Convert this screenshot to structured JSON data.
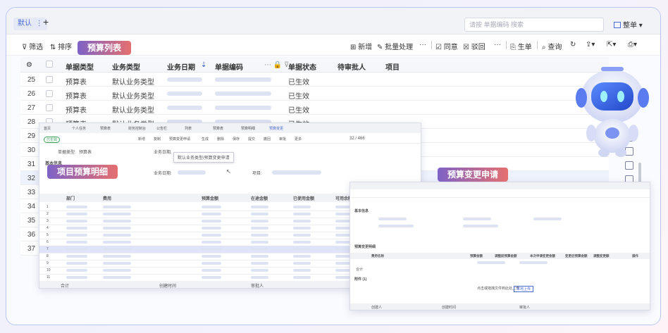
{
  "tabbar": {
    "tab_label": "默认",
    "tab_menu_icon": "⋮",
    "add_tab": "+",
    "search_placeholder": "请按 单据编码 搜索",
    "layout_label": "整单",
    "layout_icon": "layout-icon"
  },
  "toolbar": {
    "filter": "筛选",
    "sort": "排序",
    "new": "新增",
    "batch": "批量处理",
    "more": "···",
    "agree": "同意",
    "reject": "驳回",
    "generate": "生单",
    "query": "查询"
  },
  "grid": {
    "headers": [
      "单据类型",
      "业务类型",
      "业务日期",
      "单据编码",
      "单据状态",
      "待审批人",
      "项目"
    ],
    "rows": [
      {
        "no": "25",
        "type": "预算表",
        "biz": "默认业务类型",
        "status": "已生效"
      },
      {
        "no": "26",
        "type": "预算表",
        "biz": "默认业务类型",
        "status": "已生效"
      },
      {
        "no": "27",
        "type": "预算表",
        "biz": "默认业务类型",
        "status": "已生效"
      },
      {
        "no": "28",
        "type": "预算表",
        "biz": "默认业务类型",
        "status": "已生效"
      },
      {
        "no": "29",
        "type": "",
        "biz": "",
        "status": ""
      },
      {
        "no": "30",
        "type": "",
        "biz": "",
        "status": ""
      },
      {
        "no": "31",
        "type": "",
        "biz": "",
        "status": ""
      },
      {
        "no": "32",
        "type": "",
        "biz": "",
        "status": ""
      },
      {
        "no": "33",
        "type": "",
        "biz": "",
        "status": ""
      },
      {
        "no": "34",
        "type": "",
        "biz": "",
        "status": ""
      },
      {
        "no": "35",
        "type": "",
        "biz": "",
        "status": ""
      },
      {
        "no": "36",
        "type": "",
        "biz": "",
        "status": ""
      },
      {
        "no": "37",
        "type": "",
        "biz": "",
        "status": ""
      }
    ]
  },
  "badges": {
    "list": "预算列表",
    "detail": "项目预算明细",
    "change": "预算变更申请"
  },
  "shot1": {
    "tabs": [
      "首页",
      "个人任务",
      "预算表",
      "财务控制台",
      "公告栏",
      "列表",
      "预算表",
      "预算明细",
      "预算变更"
    ],
    "toolbar": [
      "新增",
      "复制",
      "预算变更申请",
      "生成",
      "删除",
      "保存",
      "提交",
      "撤回",
      "审批",
      "更多"
    ],
    "pager": "32 / 466",
    "field_type_label": "单据类型:",
    "field_type_value": "预算表",
    "field_date_label": "业务日期:",
    "field_project_label": "项目:",
    "section": "基本信息",
    "tooltip": "默认业务类型/预算变更申请",
    "table_headers": [
      "部门",
      "费用",
      "预算金额",
      "在途金额",
      "已使用金额",
      "可用余额"
    ],
    "footer": [
      "合计",
      "",
      "创建时间",
      "",
      "审批人",
      ""
    ]
  },
  "shot2": {
    "section1": "基本信息",
    "section2": "预算变更明细",
    "section3": "附件 (1)",
    "table_headers": [
      "费用名称",
      "预算金额",
      "调整前预算金额",
      "本次申请变更金额",
      "变更后预算金额",
      "调整变更额",
      "操作"
    ],
    "sum_label": "合计",
    "upload": "点击或拖拽文件到此处上传",
    "upload_btn": "本地上传",
    "footer": [
      "创建人",
      "",
      "创建时间",
      "",
      "审批人",
      ""
    ]
  },
  "colors": {
    "accent": "#4a6bd6",
    "badge_start": "#7e63c7",
    "badge_end": "#e56f6f",
    "border": "#b9c6f2"
  },
  "robot": {
    "icon": "robot-mascot-icon"
  }
}
